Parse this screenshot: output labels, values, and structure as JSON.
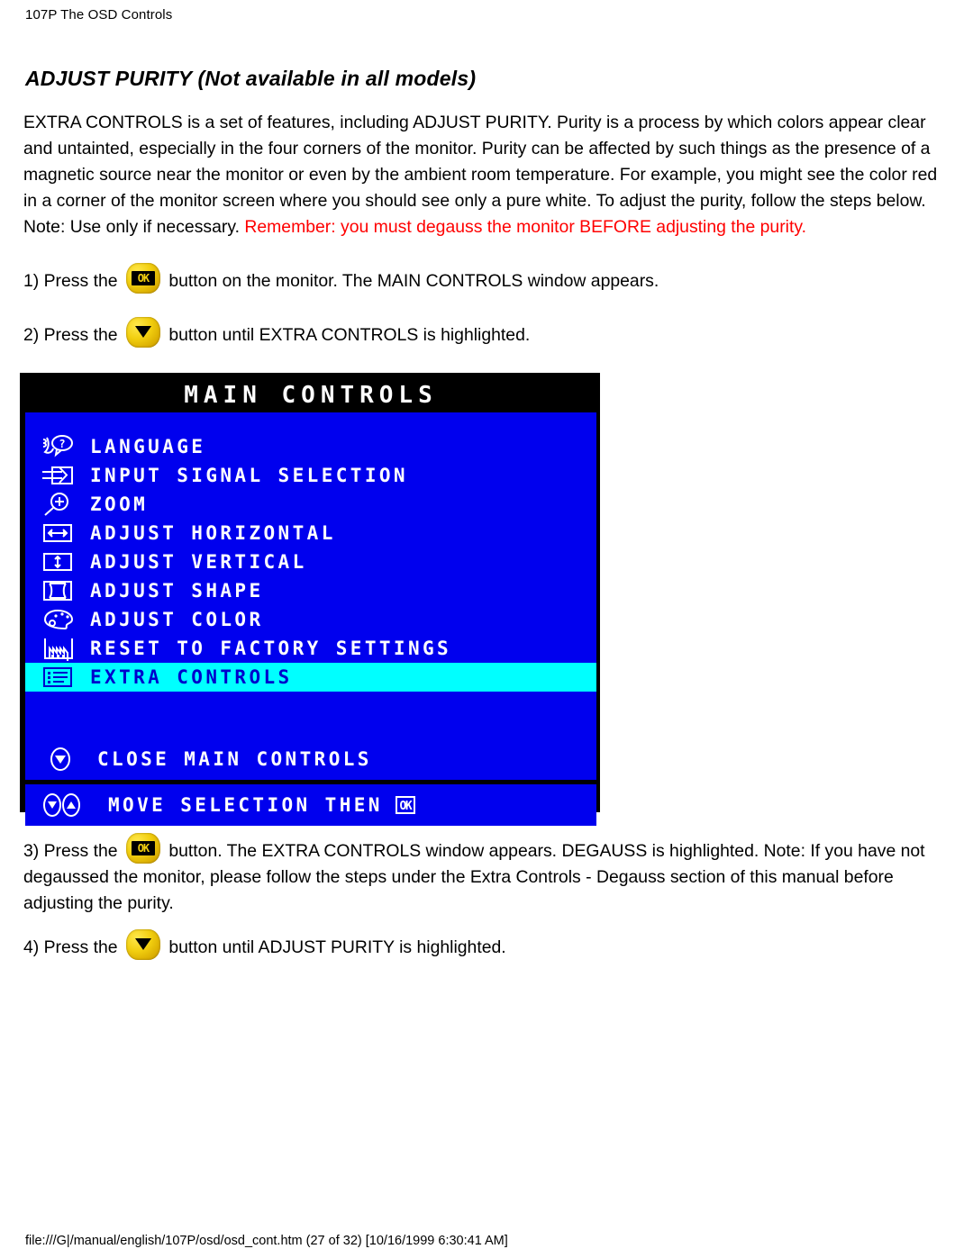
{
  "header": {
    "title": "107P The OSD Controls"
  },
  "section": {
    "title_main": "ADJUST PURITY ",
    "title_emph": "(Not available in all models)"
  },
  "intro": {
    "text_black": "EXTRA CONTROLS is a set of features, including ADJUST PURITY. Purity is a process by which colors appear clear and untainted, especially in the four corners of the monitor. Purity can be affected by such things as the presence of a magnetic source near the monitor or even by the ambient room temperature. For example, you might see the color red in a corner of the monitor screen where you should see only a pure white. To adjust the purity, follow the steps below. Note: Use only if necessary. ",
    "text_red": "Remember: you must degauss the monitor BEFORE adjusting the purity.",
    "warn_color": "#ff0000"
  },
  "steps": {
    "step1_pre": "1) Press the",
    "step1_post": "button on the monitor. The MAIN CONTROLS window appears.",
    "step2_pre": "2) Press the",
    "step2_post": "button until EXTRA CONTROLS is highlighted.",
    "step3_pre": "3) Press the",
    "step3_post": "button. The EXTRA CONTROLS window appears. DEGAUSS is highlighted. Note: If you have not degaussed the monitor, please follow the steps under the Extra Controls - Degauss section of this manual before adjusting the purity.",
    "step4_pre": "4) Press the",
    "step4_post": "button until ADJUST PURITY is highlighted."
  },
  "buttons": {
    "ok_label": "OK",
    "down_icon": "triangle-down-icon"
  },
  "osd": {
    "title": "MAIN CONTROLS",
    "background": "#0000ee",
    "highlight": "#00ffff",
    "highlight_text": "#0000cc",
    "items": [
      {
        "label": "LANGUAGE",
        "icon": "language-face-question-icon",
        "selected": false
      },
      {
        "label": "INPUT SIGNAL SELECTION",
        "icon": "input-signal-arrow-icon",
        "selected": false
      },
      {
        "label": "ZOOM",
        "icon": "magnifier-plus-icon",
        "selected": false
      },
      {
        "label": "ADJUST HORIZONTAL",
        "icon": "horizontal-arrows-icon",
        "selected": false
      },
      {
        "label": "ADJUST VERTICAL",
        "icon": "vertical-arrows-icon",
        "selected": false
      },
      {
        "label": "ADJUST SHAPE",
        "icon": "shape-pincushion-icon",
        "selected": false
      },
      {
        "label": "ADJUST COLOR",
        "icon": "color-palette-icon",
        "selected": false
      },
      {
        "label": "RESET TO FACTORY SETTINGS",
        "icon": "factory-icon",
        "selected": false
      },
      {
        "label": "EXTRA CONTROLS",
        "icon": "list-document-icon",
        "selected": true
      }
    ],
    "close_label": "CLOSE MAIN CONTROLS",
    "close_icon": "down-arrow-oval-icon",
    "footer_label": "MOVE SELECTION THEN",
    "footer_icons": "down-arrow-oval-icon up-arrow-oval-icon",
    "footer_ok": "OK"
  },
  "footer": {
    "path": "file:///G|/manual/english/107P/osd/osd_cont.htm (27 of 32) [10/16/1999 6:30:41 AM]"
  }
}
